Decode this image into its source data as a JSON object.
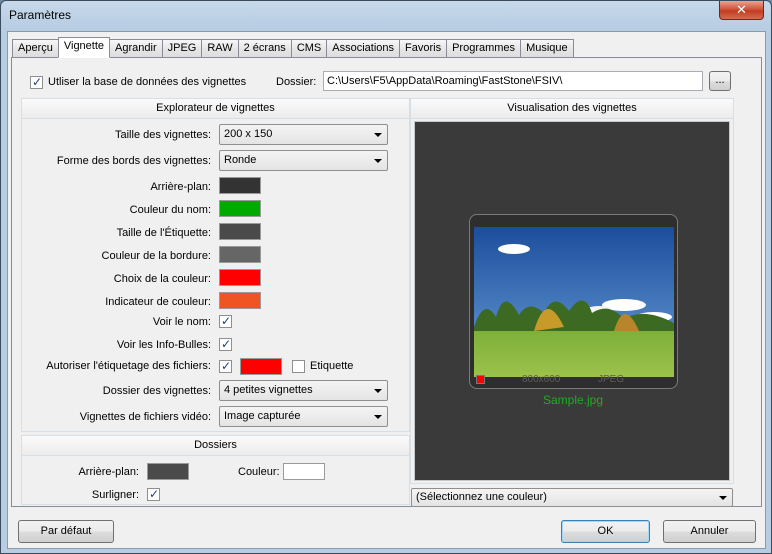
{
  "window": {
    "title": "Paramètres",
    "close_label": "✕"
  },
  "tabs": [
    {
      "label": "Aperçu"
    },
    {
      "label": "Vignette"
    },
    {
      "label": "Agrandir"
    },
    {
      "label": "JPEG"
    },
    {
      "label": "RAW"
    },
    {
      "label": "2 écrans"
    },
    {
      "label": "CMS"
    },
    {
      "label": "Associations"
    },
    {
      "label": "Favoris"
    },
    {
      "label": "Programmes"
    },
    {
      "label": "Musique"
    }
  ],
  "top": {
    "use_db_label": "Utliser la base de données des vignettes",
    "use_db_checked": true,
    "folder_label": "Dossier:",
    "folder_value": "C:\\Users\\F5\\AppData\\Roaming\\FastStone\\FSIV\\",
    "browse_label": "..."
  },
  "explorer": {
    "header": "Explorateur de vignettes",
    "thumb_size_label": "Taille des vignettes:",
    "thumb_size_value": "200 x 150",
    "border_shape_label": "Forme des bords des vignettes:",
    "border_shape_value": "Ronde",
    "background_label": "Arrière-plan:",
    "name_color_label": "Couleur du nom:",
    "label_size_label": "Taille de l'Étiquette:",
    "border_color_label": "Couleur de la bordure:",
    "color_choice_label": "Choix de la couleur:",
    "color_indicator_label": "Indicateur de couleur:",
    "show_name_label": "Voir le nom:",
    "show_infobulles_label": "Voir les Info-Bulles:",
    "allow_tagging_label": "Autoriser l'étiquetage des fichiers:",
    "etiquette_label": "Etiquette",
    "thumb_folder_label": "Dossier des vignettes:",
    "thumb_folder_value": "4 petites vignettes",
    "video_thumbs_label": "Vignettes de fichiers vidéo:",
    "video_thumbs_value": "Image capturée"
  },
  "colors": {
    "background": "#333333",
    "name": "#00aa00",
    "label_size": "#4a4a4a",
    "border": "#666666",
    "choice": "#ff0000",
    "indicator": "#ee5522",
    "tagging": "#ff0000",
    "dossiers_bg": "#4a4a4a",
    "dossiers_color": "#ffffff"
  },
  "checks": {
    "show_name": true,
    "show_infobulles": true,
    "allow_tagging": true,
    "etiquette": false,
    "surligner": true
  },
  "dossiers": {
    "header": "Dossiers",
    "background_label": "Arrière-plan:",
    "color_label": "Couleur:",
    "highlight_label": "Surligner:"
  },
  "preview": {
    "header": "Visualisation des vignettes",
    "dims": "800x600",
    "format": "JPEG",
    "filename": "Sample.jpg",
    "color_select": "(Sélectionnez une couleur)"
  },
  "buttons": {
    "default": "Par défaut",
    "ok": "OK",
    "cancel": "Annuler"
  }
}
